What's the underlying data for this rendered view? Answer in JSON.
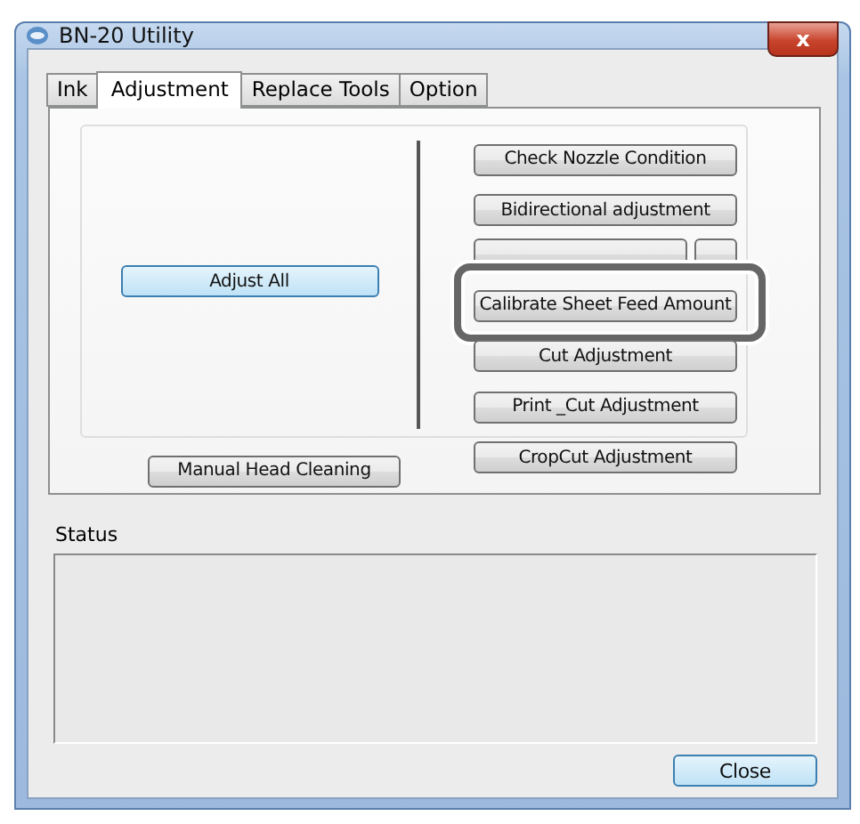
{
  "window": {
    "title": "BN-20 Utility",
    "close_glyph": "x"
  },
  "tabs": [
    {
      "label": "Ink",
      "selected": false
    },
    {
      "label": "Adjustment",
      "selected": true
    },
    {
      "label": "Replace Tools",
      "selected": false
    },
    {
      "label": "Option",
      "selected": false
    }
  ],
  "adjust_all": {
    "label": "Adjust All",
    "default": true
  },
  "adjustment_buttons": [
    {
      "kind": "button",
      "label": "Check Nozzle Condition",
      "highlighted": false
    },
    {
      "kind": "button",
      "label": "Bidirectional adjustment",
      "highlighted": false
    },
    {
      "kind": "covered"
    },
    {
      "kind": "button",
      "label": "Calibrate Sheet Feed Amount",
      "highlighted": true
    },
    {
      "kind": "button",
      "label": "Cut Adjustment",
      "highlighted": false
    },
    {
      "kind": "button",
      "label": "Print _Cut Adjustment",
      "highlighted": false
    },
    {
      "kind": "button",
      "label": "CropCut Adjustment",
      "highlighted": false
    }
  ],
  "manual_head_cleaning": {
    "label": "Manual Head Cleaning"
  },
  "status": {
    "label": "Status"
  },
  "buttons": [
    {
      "label": "Close",
      "default": true
    }
  ]
}
